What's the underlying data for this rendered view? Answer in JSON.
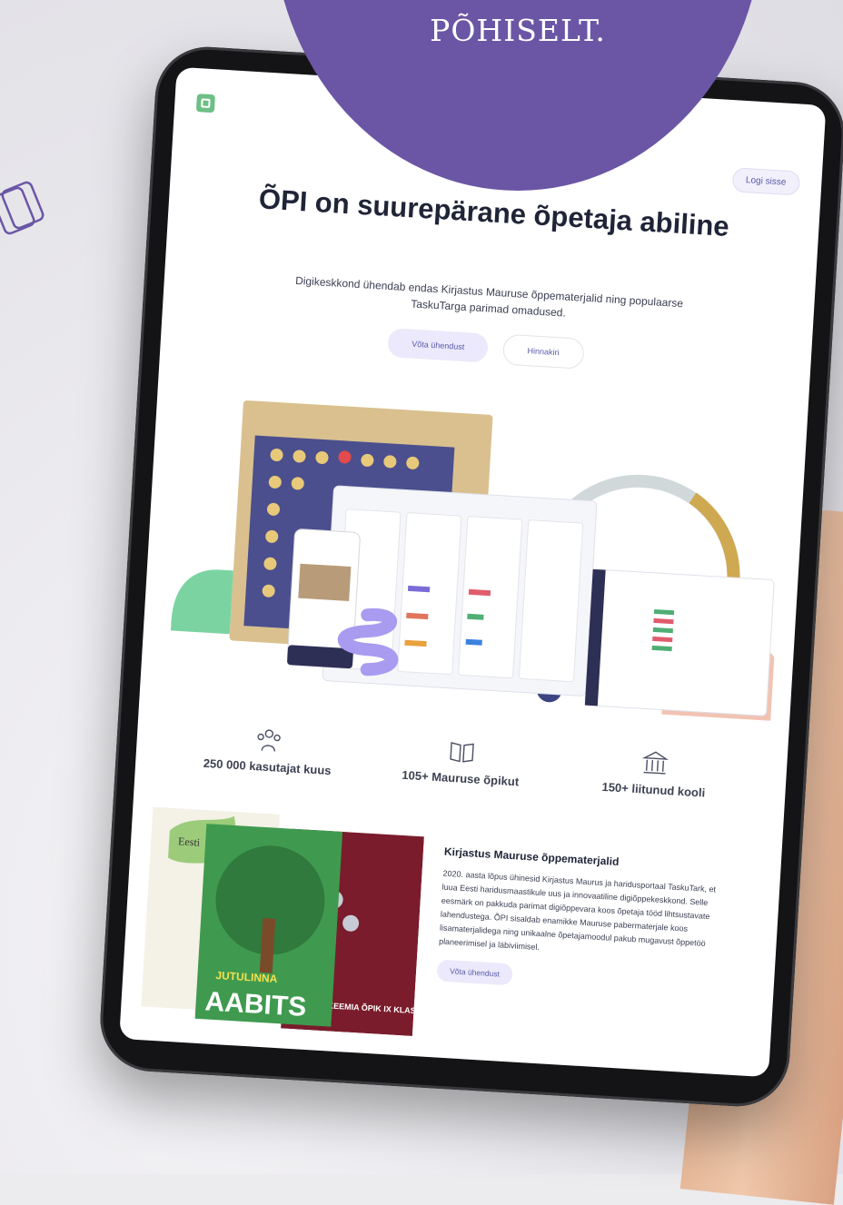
{
  "banner": {
    "text": "PÕHISELT."
  },
  "site": {
    "login_label": "Logi sisse",
    "hero_title": "ÕPI on suurepärane õpetaja abiline",
    "hero_subtitle": "Digikeskkond ühendab endas Kirjastus Mauruse õppematerjalid ning populaarse TaskuTarga parimad omadused.",
    "primary_cta": "Võta ühendust",
    "secondary_cta": "Hinnakiri"
  },
  "stats": [
    {
      "icon": "users-icon",
      "label": "250 000 kasutajat kuus"
    },
    {
      "icon": "book-icon",
      "label": "105+ Mauruse õpikut"
    },
    {
      "icon": "school-icon",
      "label": "150+ liitunud kooli"
    }
  ],
  "books": {
    "left_cover_title": "Eesti",
    "center_cover_title": "AABITS",
    "center_cover_sub": "JUTULINNA",
    "right_cover_title": "KEEMIA ÕPIK IX KLASSILE"
  },
  "kirjastus": {
    "title": "Kirjastus Mauruse õppematerjalid",
    "text": "2020. aasta lõpus ühinesid Kirjastus Maurus ja haridusportaal TaskuTark, et luua Eesti haridusmaastikule uus ja innovaatiline digiõppekeskkond. Selle eesmärk on pakkuda parimat digiõppevara koos õpetaja tööd lihtsustavate lahendustega. ÕPI sisaldab enamikke Mauruse pabermaterjale koos lisamaterjalidega ning unikaalne õpetajamoodul pakub mugavust õppetöö planeerimisel ja läbiviimisel.",
    "cta": "Võta ühendust"
  },
  "colors": {
    "brand_purple": "#6a56a5",
    "accent_green": "#6dbf85",
    "text_dark": "#1f2437"
  }
}
